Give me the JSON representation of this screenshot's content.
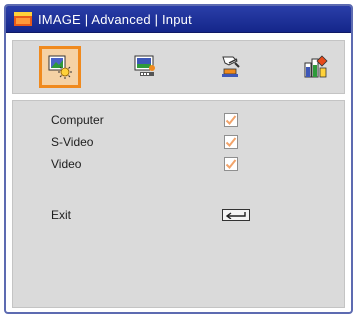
{
  "window": {
    "title": "IMAGE | Advanced | Input",
    "title_icon": "image-menu-icon"
  },
  "tabs": [
    {
      "icon": "image-tab-icon",
      "active": true
    },
    {
      "icon": "display-tab-icon",
      "active": false
    },
    {
      "icon": "setup-tab-icon",
      "active": false
    },
    {
      "icon": "options-tab-icon",
      "active": false
    }
  ],
  "inputs": [
    {
      "label": "Computer",
      "checked": true
    },
    {
      "label": "S-Video",
      "checked": true
    },
    {
      "label": "Video",
      "checked": true
    }
  ],
  "exit": {
    "label": "Exit",
    "icon": "enter-key-icon"
  },
  "colors": {
    "title_bar": "#1e3399",
    "active_tab_border": "#f08a1e",
    "panel_background": "#dadada",
    "checkmark": "#f2a46b"
  }
}
